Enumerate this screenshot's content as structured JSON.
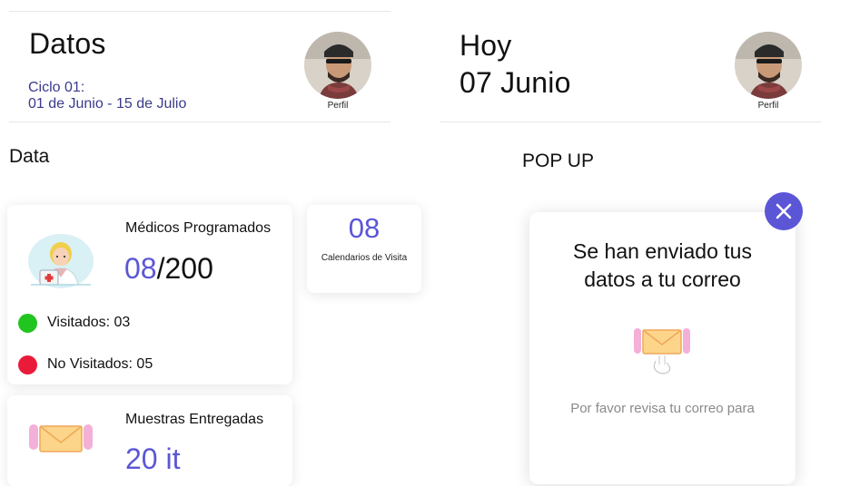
{
  "left": {
    "title": "Datos",
    "cycle_line1": "Ciclo 01:",
    "cycle_line2": "01 de Junio - 15 de Julio",
    "profile_label": "Perfil",
    "section_title": "Data",
    "doctors_card": {
      "title": "Médicos Programados",
      "count_done": "08",
      "count_total": "/200",
      "visited_label": "Visitados: 03",
      "not_visited_label": "No Visitados: 05"
    },
    "calendar_card": {
      "count": "08",
      "label": "Calendarios de Visita"
    },
    "samples_card": {
      "title": "Muestras Entregadas",
      "count_partial": "20 it"
    }
  },
  "right": {
    "title_line1": "Hoy",
    "title_line2": "07 Junio",
    "profile_label": "Perfil",
    "section_title": "POP UP",
    "popup": {
      "heading_line1": "Se han enviado tus",
      "heading_line2": "datos a tu correo",
      "message": "Por favor revisa tu correo para"
    }
  },
  "colors": {
    "accent": "#5b56d6",
    "cycle_text": "#3a3a8c",
    "visited": "#22c41f",
    "not_visited": "#ea1b3a"
  },
  "icons": {
    "avatar": "profile-photo",
    "doctor": "doctor-illustration",
    "mail": "envelope-rocket-illustration",
    "close": "close-icon"
  }
}
